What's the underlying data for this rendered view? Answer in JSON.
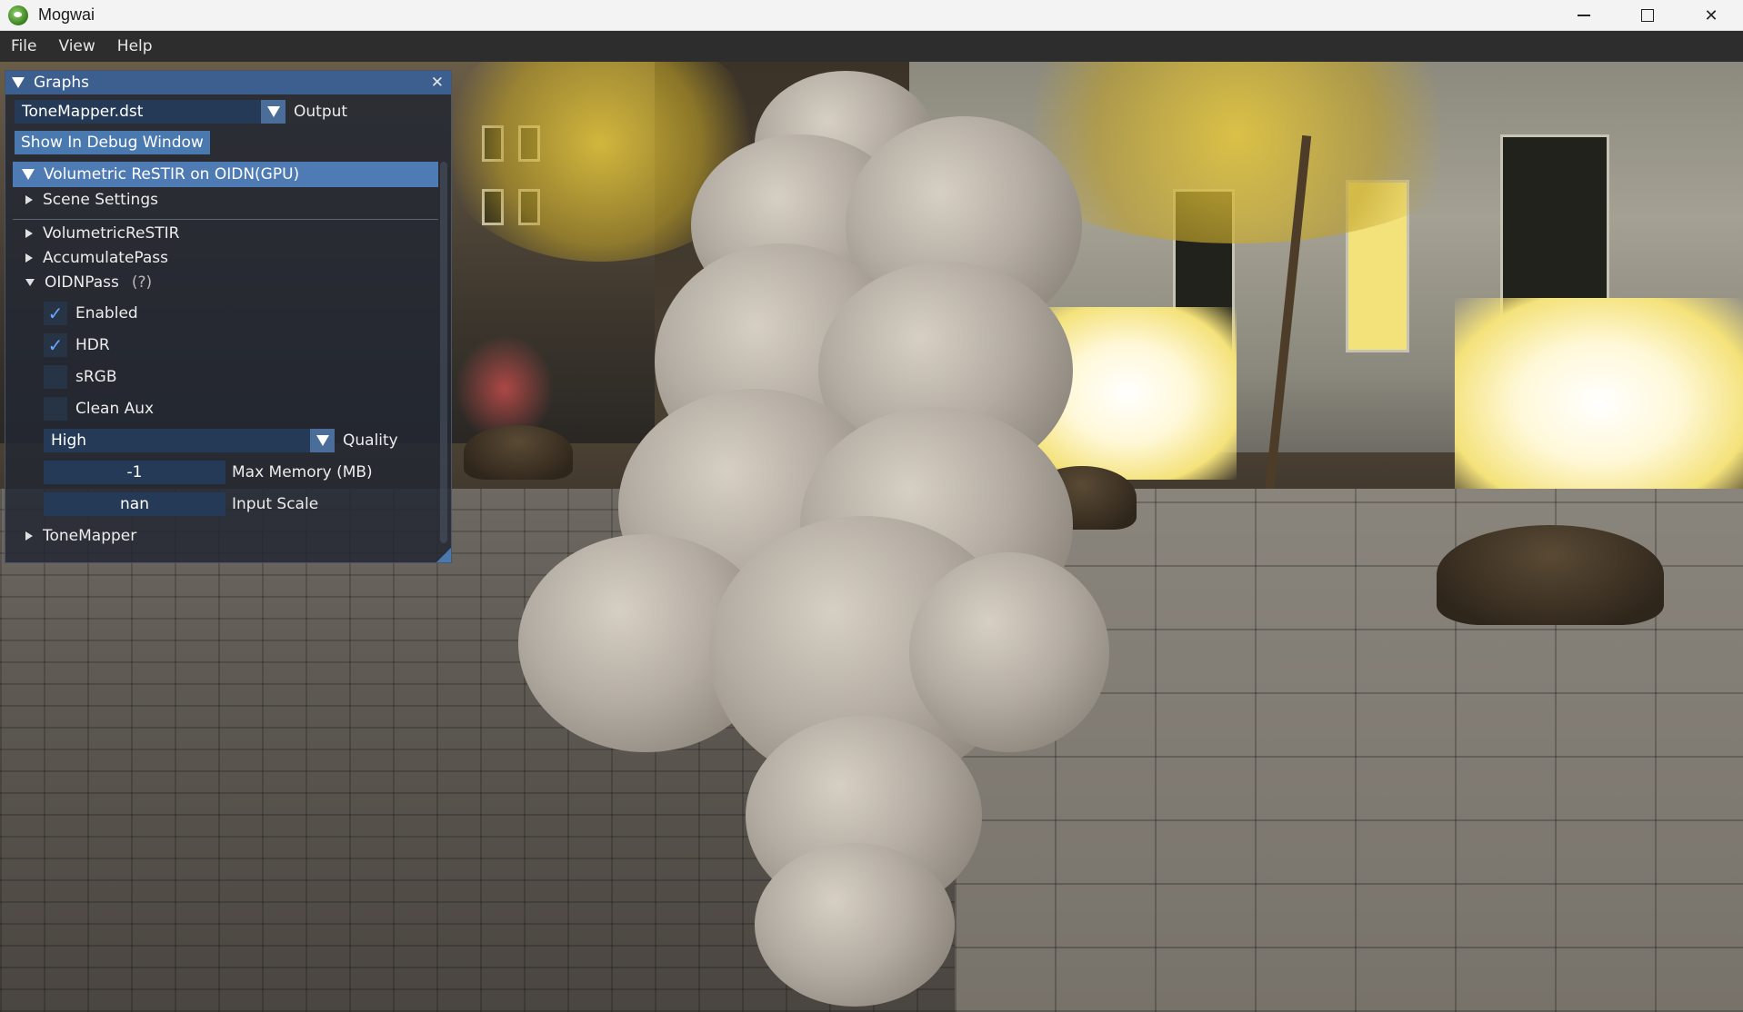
{
  "window": {
    "title": "Mogwai",
    "minimize_label": "",
    "close_label": "✕"
  },
  "menu": {
    "items": [
      "File",
      "View",
      "Help"
    ]
  },
  "graphs_panel": {
    "title": "Graphs",
    "output_combo": {
      "value": "ToneMapper.dst",
      "label": "Output"
    },
    "debug_button": "Show In Debug Window",
    "graph_header": "Volumetric ReSTIR on OIDN(GPU)",
    "tree": {
      "scene_settings": "Scene Settings",
      "volumetric_restir": "VolumetricReSTIR",
      "accumulate_pass": "AccumulatePass",
      "oidn_pass": "OIDNPass",
      "oidn_help": "(?)",
      "tone_mapper": "ToneMapper"
    },
    "oidn": {
      "enabled": {
        "label": "Enabled",
        "checked": true
      },
      "hdr": {
        "label": "HDR",
        "checked": true
      },
      "srgb": {
        "label": "sRGB",
        "checked": false
      },
      "clean_aux": {
        "label": "Clean Aux",
        "checked": false
      },
      "quality": {
        "value": "High",
        "label": "Quality"
      },
      "max_memory": {
        "value": "-1",
        "label": "Max Memory (MB)"
      },
      "input_scale": {
        "value": "nan",
        "label": "Input Scale"
      }
    }
  },
  "icons": {
    "app": "mogwai-logo-icon",
    "check": "✓"
  }
}
